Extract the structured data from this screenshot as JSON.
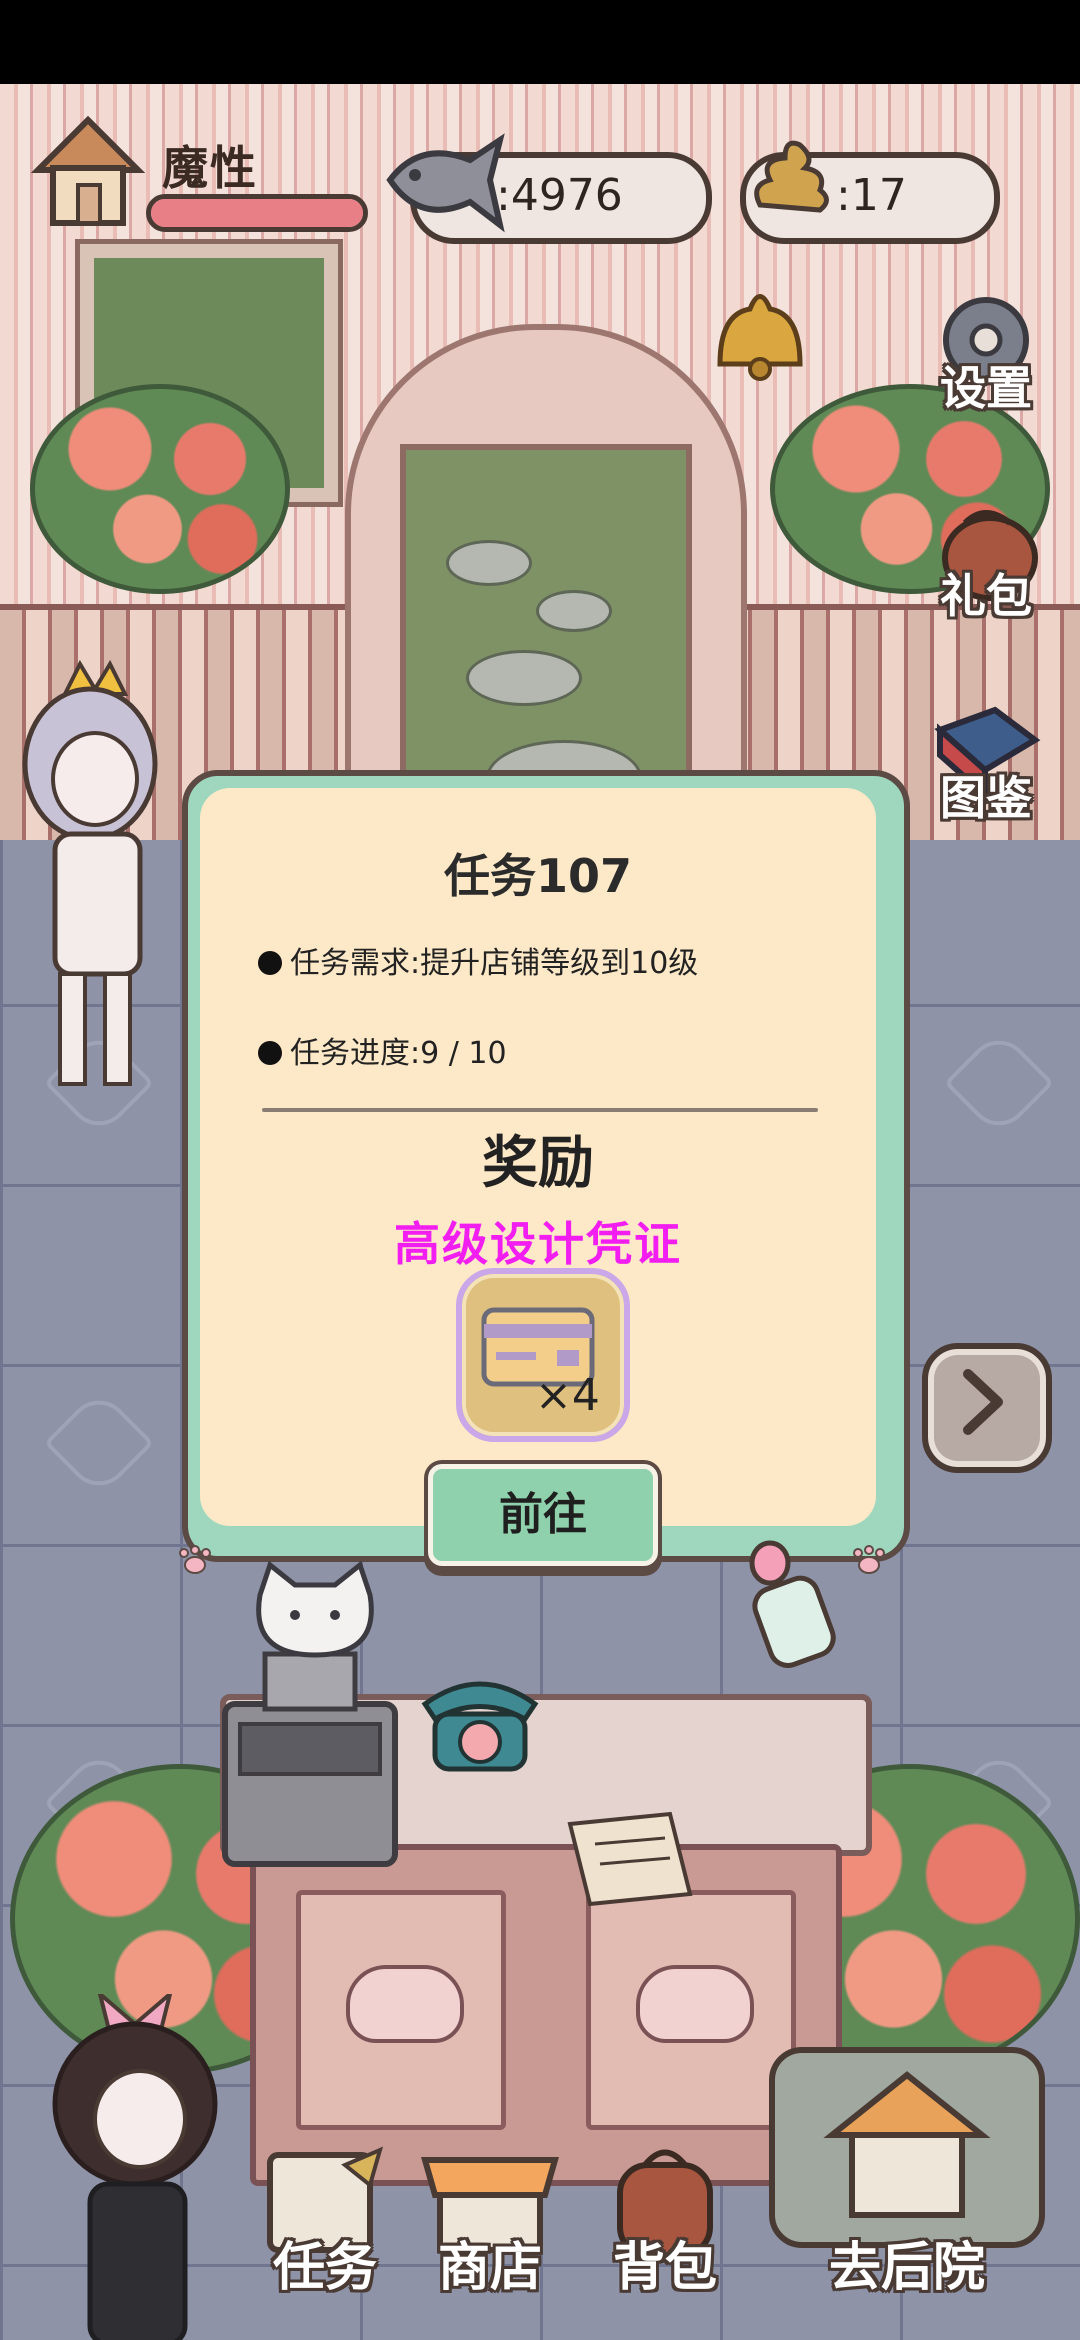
{
  "player": {
    "name": "魔性",
    "hp_fraction": 1.0
  },
  "resources": {
    "fish": {
      "icon": "fish-icon",
      "value": ":4976"
    },
    "poop": {
      "icon": "poop-icon",
      "value": ":17"
    }
  },
  "side_menu": {
    "settings": "设置",
    "gift": "礼包",
    "collection": "图鉴"
  },
  "task": {
    "title": "任务107",
    "requirement": "任务需求:提升店铺等级到10级",
    "progress": "任务进度:9 / 10",
    "reward_heading": "奖励",
    "reward_name": "高级设计凭证",
    "reward_qty": "×4",
    "go_button": "前往"
  },
  "bottom_nav": {
    "tasks": "任务",
    "shop": "商店",
    "bag": "背包",
    "backyard": "去后院"
  },
  "colors": {
    "modal_bg": "#fde9c8",
    "modal_border": "#9ed7bd",
    "reward_name": "#f21df0",
    "go_button": "#8fd0ad",
    "hp_bar": "#e97f86"
  }
}
